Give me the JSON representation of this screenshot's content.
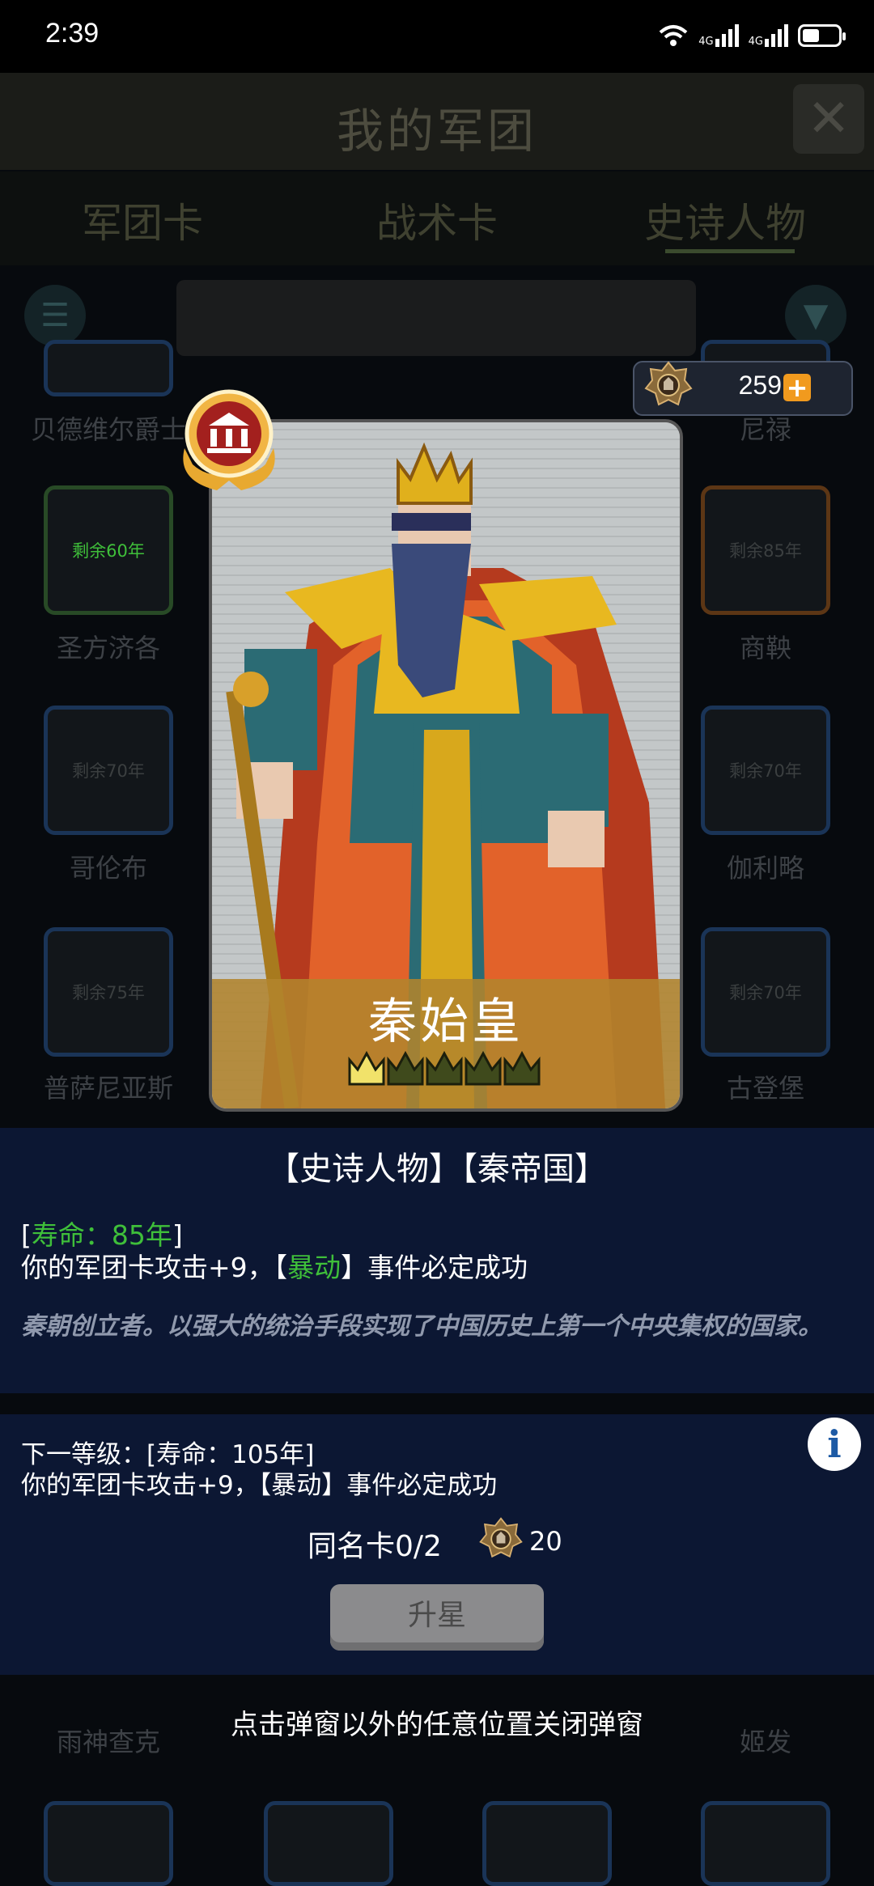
{
  "status_bar": {
    "time": "2:39",
    "signal_1": "4G",
    "signal_2": "4G"
  },
  "background": {
    "title": "我的军团",
    "tabs": [
      "军团卡",
      "战术卡",
      "史诗人物"
    ],
    "cards": [
      {
        "label": "贝德维尔爵士",
        "remaining": ""
      },
      {
        "label": "尼禄",
        "remaining": ""
      },
      {
        "label": "圣方济各",
        "remaining": "剩余60年"
      },
      {
        "label": "商鞅",
        "remaining": "剩余85年"
      },
      {
        "label": "哥伦布",
        "remaining": "剩余70年"
      },
      {
        "label": "伽利略",
        "remaining": "剩余70年"
      },
      {
        "label": "普萨尼亚斯",
        "remaining": "剩余75年"
      },
      {
        "label": "古登堡",
        "remaining": "剩余70年"
      },
      {
        "label": "雨神查克",
        "remaining": ""
      },
      {
        "label": "姬发",
        "remaining": ""
      }
    ]
  },
  "coins": {
    "value": "259",
    "plus": "+"
  },
  "hero": {
    "name": "秦始皇",
    "stars": 1,
    "max_stars": 5,
    "faction_line": "【史诗人物】【秦帝国】",
    "life_open": "[",
    "life_label": "寿命：85年",
    "life_close": "]",
    "effect_prefix": "你的军团卡攻击+9，【",
    "effect_keyword": "暴动",
    "effect_suffix": "】事件必定成功",
    "description": "秦朝创立者。以强大的统治手段实现了中国历史上第一个中央集权的国家。",
    "next_level_title": "下一等级：[寿命：105年]",
    "next_level_effect": "你的军团卡攻击+9，【暴动】事件必定成功",
    "same_card_label": "同名卡0/2",
    "upgrade_cost": "20",
    "upgrade_button": "升星"
  },
  "close_hint": "点击弹窗以外的任意位置关闭弹窗",
  "info_icon": "i"
}
